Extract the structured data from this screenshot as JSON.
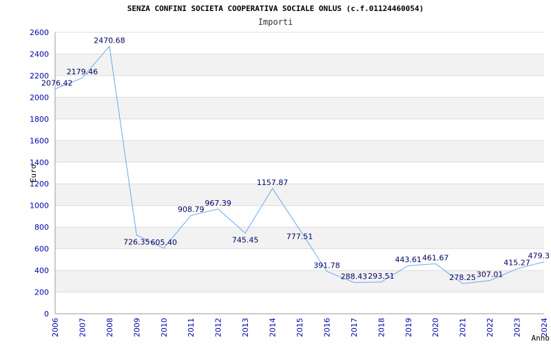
{
  "chart_title": "SENZA CONFINI SOCIETA COOPERATIVA SOCIALE ONLUS (c.f.01124460054)",
  "chart_data": {
    "type": "line",
    "title": "Importi",
    "xlabel": "Anno",
    "ylabel": "Euro",
    "x": [
      "2006",
      "2007",
      "2008",
      "2009",
      "2010",
      "2011",
      "2012",
      "2013",
      "2014",
      "2015",
      "2016",
      "2017",
      "2018",
      "2019",
      "2020",
      "2021",
      "2022",
      "2023",
      "2024"
    ],
    "values": [
      2076.42,
      2179.46,
      2470.68,
      726.35,
      605.4,
      908.79,
      967.39,
      745.45,
      1157.87,
      777.51,
      391.78,
      288.43,
      293.51,
      443.61,
      461.67,
      278.25,
      307.01,
      415.27,
      479.3
    ],
    "labels": [
      "2076.42",
      "2179.46",
      "2470.68",
      "726.35",
      "605.40",
      "908.79",
      "967.39",
      "745.45",
      "1157.87",
      "777.51",
      "391.78",
      "288.43",
      "293.51",
      "443.61",
      "461.67",
      "278.25",
      "307.01",
      "415.27",
      "479.3"
    ],
    "ylim": [
      0,
      2600
    ],
    "yticks": [
      0,
      200,
      400,
      600,
      800,
      1000,
      1200,
      1400,
      1600,
      1800,
      2000,
      2200,
      2400,
      2600
    ],
    "grid": true,
    "line_color": "#66aaee",
    "band_color": "#f2f2f2",
    "tick_color": "#0000aa"
  }
}
